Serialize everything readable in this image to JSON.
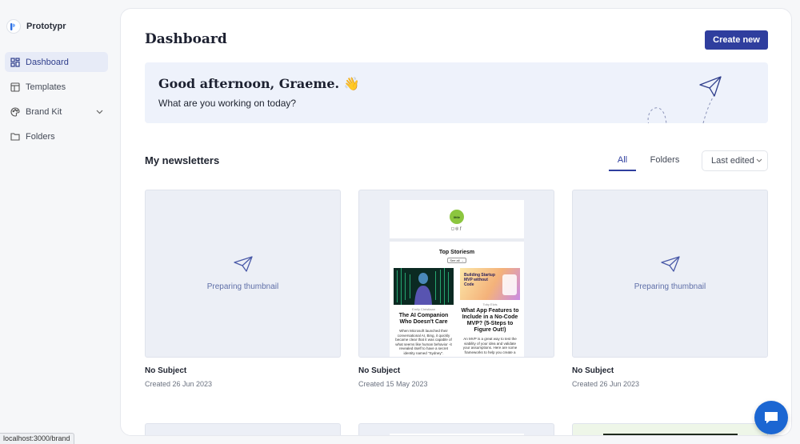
{
  "app": {
    "name": "Prototypr"
  },
  "sidebar": {
    "items": [
      {
        "label": "Dashboard",
        "icon": "dashboard-grid-icon",
        "active": true
      },
      {
        "label": "Templates",
        "icon": "templates-icon",
        "active": false
      },
      {
        "label": "Brand Kit",
        "icon": "palette-icon",
        "active": false,
        "expandable": true
      },
      {
        "label": "Folders",
        "icon": "folder-icon",
        "active": false
      }
    ]
  },
  "header": {
    "title": "Dashboard",
    "create_label": "Create new"
  },
  "greeting": {
    "title": "Good afternoon, Graeme. 👋",
    "subtitle": "What are you working on today?"
  },
  "newsletters": {
    "title": "My newsletters",
    "tabs": [
      {
        "label": "All",
        "active": true
      },
      {
        "label": "Folders",
        "active": false
      }
    ],
    "sort": {
      "selected": "Last edited"
    },
    "cards": [
      {
        "subject": "No Subject",
        "date": "Created 26 Jun 2023",
        "thumbnail": "Preparing thumbnail"
      },
      {
        "subject": "No Subject",
        "date": "Created 15 May 2023",
        "preview": {
          "logo_text": "little",
          "section_title": "Top Storiesm",
          "see_all": "See all →",
          "articles": [
            {
              "author": "Emily Christiaan",
              "headline": "The AI Companion Who Doesn't Care",
              "excerpt": "When Microsoft launched their conversational AI, Bing, it quickly became clear that it was capable of what seems like human behavior -it revealed itself to have a secret identity named \"Sydney\"."
            },
            {
              "author": "Toby Elvis",
              "image_title": "Building Startup MVP without Code",
              "headline": "What App Features to Include in a No-Code MVP? (5-Steps to Figure Out!)",
              "excerpt": "An MVP is a great way to test the viability of your idea and validate your assumptions. Here are some frameworks to help you create a"
            }
          ]
        }
      },
      {
        "subject": "No Subject",
        "date": "Created 26 Jun 2023",
        "thumbnail": "Preparing thumbnail"
      }
    ]
  },
  "status_bar": {
    "url": "localhost:3000/brand"
  },
  "colors": {
    "accent": "#2f3e9e",
    "greeting_bg": "#eef2fb",
    "chat": "#1b66d2"
  }
}
